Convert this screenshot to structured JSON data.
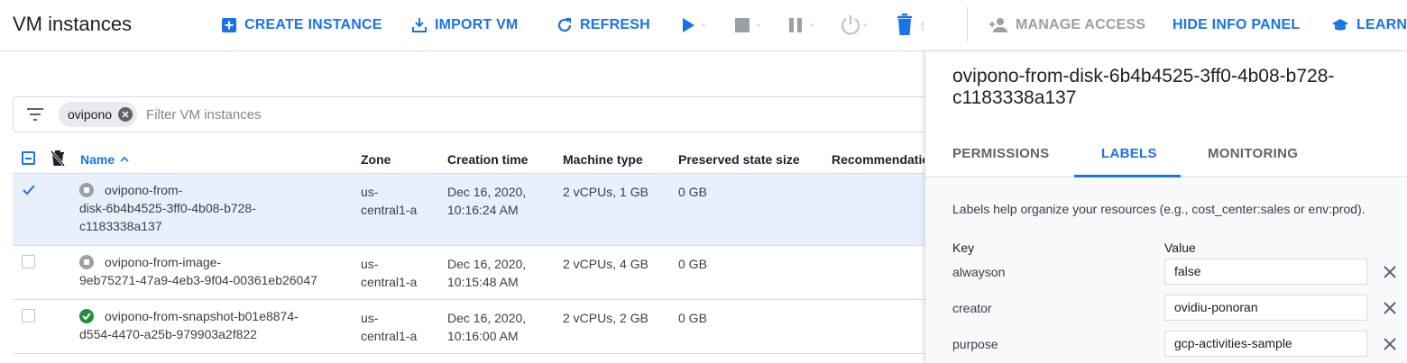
{
  "page": {
    "title": "VM instances"
  },
  "toolbar": {
    "create_instance": "CREATE INSTANCE",
    "import_vm": "IMPORT VM",
    "refresh": "REFRESH",
    "manage_access": "MANAGE ACCESS",
    "hide_info_panel": "HIDE INFO PANEL",
    "learn": "LEARN"
  },
  "filter": {
    "chip": "ovipono",
    "placeholder": "Filter VM instances"
  },
  "table": {
    "columns": {
      "name": "Name",
      "zone": "Zone",
      "creation_time": "Creation time",
      "machine_type": "Machine type",
      "preserved_state_size": "Preserved state size",
      "recommendation": "Recommendation"
    },
    "rows": [
      {
        "name_lines": [
          "ovipono-from-",
          "disk-6b4b4525-3ff0-4b08-b728-",
          "c1183338a137"
        ],
        "zone_lines": [
          "us-",
          "central1-a"
        ],
        "time_lines": [
          "Dec 16, 2020,",
          "10:16:24 AM"
        ],
        "machine": "2 vCPUs, 1 GB",
        "preserved": "0 GB",
        "status": "stopped",
        "selected": true
      },
      {
        "name_lines": [
          "ovipono-from-image-",
          "9eb75271-47a9-4eb3-9f04-00361eb26047"
        ],
        "zone_lines": [
          "us-",
          "central1-a"
        ],
        "time_lines": [
          "Dec 16, 2020,",
          "10:15:48 AM"
        ],
        "machine": "2 vCPUs, 4 GB",
        "preserved": "0 GB",
        "status": "stopped",
        "selected": false
      },
      {
        "name_lines": [
          "ovipono-from-snapshot-b01e8874-",
          "d554-4470-a25b-979903a2f822"
        ],
        "zone_lines": [
          "us-",
          "central1-a"
        ],
        "time_lines": [
          "Dec 16, 2020,",
          "10:16:00 AM"
        ],
        "machine": "2 vCPUs, 2 GB",
        "preserved": "0 GB",
        "status": "running",
        "selected": false
      }
    ]
  },
  "panel": {
    "title_line1": "ovipono-from-disk-6b4b4525-3ff0-4b08-b728-",
    "title_line2": "c1183338a137",
    "tabs": [
      "PERMISSIONS",
      "LABELS",
      "MONITORING"
    ],
    "active_tab": "LABELS",
    "help_text": "Labels help organize your resources (e.g., cost_center:sales or env:prod).",
    "key_header": "Key",
    "value_header": "Value",
    "labels": [
      {
        "key": "alwayson",
        "value": "false"
      },
      {
        "key": "creator",
        "value": "ovidiu-ponoran"
      },
      {
        "key": "purpose",
        "value": "gcp-activities-sample"
      }
    ]
  },
  "colors": {
    "accent": "#1a73e8",
    "running": "#1e8e3e",
    "stopped": "#9aa0a6"
  }
}
